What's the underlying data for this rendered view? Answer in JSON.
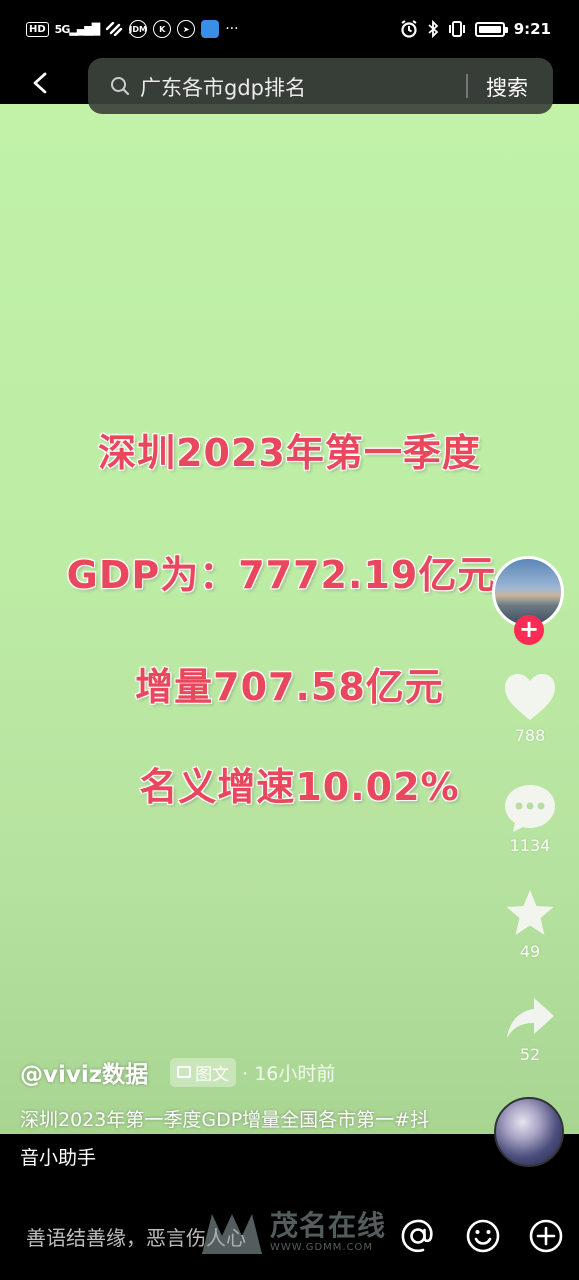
{
  "status_bar": {
    "left_badge": "HD",
    "signal": "5G",
    "icons": [
      "hd-badge",
      "signal-icon",
      "wifi-icon",
      "jdm-app-icon",
      "k-app-icon",
      "app-icon",
      "blue-app-icon",
      "more-dots"
    ],
    "dots": "···",
    "time": "9:21"
  },
  "search": {
    "query": "广东各市gdp排名",
    "button": "搜索"
  },
  "overlay": {
    "line1": "深圳2023年第一季度",
    "line2": "GDP为：7772.19亿元",
    "line3": "增量707.58亿元",
    "line4": "名义增速10.02%"
  },
  "actions": {
    "likes": "788",
    "comments": "1134",
    "favorites": "49",
    "shares": "52"
  },
  "post": {
    "author": "@viviz数据",
    "tag": "图文",
    "time": "· 16小时前",
    "desc": "深圳2023年第一季度GDP增量全国各市第一#抖音小助手"
  },
  "comment_bar": {
    "placeholder": "善语结善缘，恶言伤人心"
  },
  "watermark": {
    "brand": "茂名在线",
    "url": "WWW.GDMM.COM"
  },
  "colors": {
    "accent": "#fe2c55",
    "overlay_text": "#e8475c",
    "background": "#c1f2a8"
  }
}
